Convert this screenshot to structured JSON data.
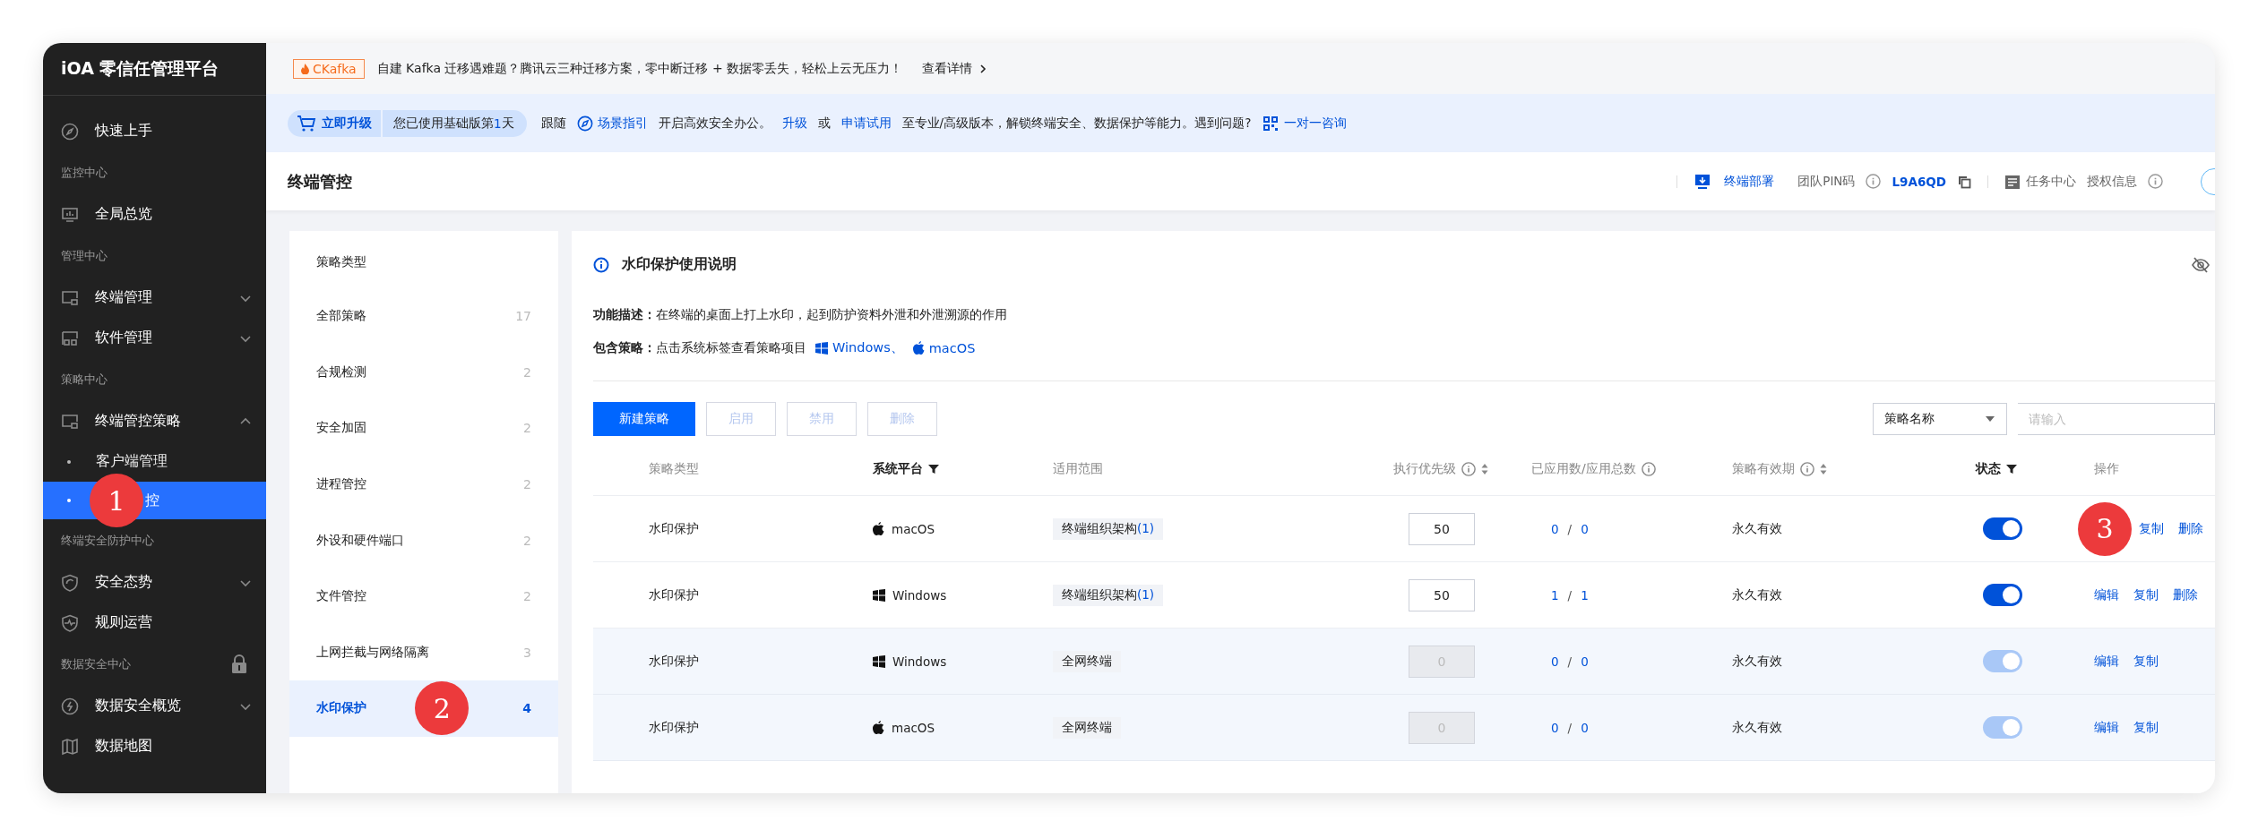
{
  "sidebar": {
    "title": "iOA 零信任管理平台",
    "items": [
      {
        "kind": "item",
        "label": "快速上手"
      },
      {
        "kind": "group",
        "label": "监控中心"
      },
      {
        "kind": "item",
        "label": "全局总览"
      },
      {
        "kind": "group",
        "label": "管理中心"
      },
      {
        "kind": "item",
        "label": "终端管理",
        "expanded": false
      },
      {
        "kind": "item",
        "label": "软件管理",
        "expanded": false
      },
      {
        "kind": "group",
        "label": "策略中心"
      },
      {
        "kind": "item",
        "label": "终端管控策略",
        "expanded": true
      },
      {
        "kind": "subitem",
        "label": "客户端管理",
        "selected": false
      },
      {
        "kind": "subitem",
        "label": "控",
        "selected": true,
        "marker": "1"
      },
      {
        "kind": "group",
        "label": "终端安全防护中心"
      },
      {
        "kind": "item",
        "label": "安全态势",
        "expanded": false
      },
      {
        "kind": "item",
        "label": "规则运营"
      },
      {
        "kind": "group",
        "label": "数据安全中心",
        "locked": true
      },
      {
        "kind": "item",
        "label": "数据安全概览",
        "expanded": false
      },
      {
        "kind": "item",
        "label": "数据地图"
      }
    ]
  },
  "promo": {
    "tag": "CKafka",
    "text": "自建 Kafka 迁移遇难题？腾讯云三种迁移方案，零中断迁移 + 数据零丢失，轻松上云无压力！",
    "link": "查看详情"
  },
  "upgrade": {
    "button": "立即升级",
    "usage_prefix": "您已使用基础版第",
    "usage_days": "1",
    "usage_suffix": "天",
    "parts": [
      {
        "kind": "text",
        "text": "跟随"
      },
      {
        "kind": "guide",
        "text": "场景指引"
      },
      {
        "kind": "text",
        "text": "开启高效安全办公。"
      },
      {
        "kind": "link",
        "text": "升级"
      },
      {
        "kind": "text",
        "text": "或"
      },
      {
        "kind": "link",
        "text": "申请试用"
      },
      {
        "kind": "text",
        "text": "至专业/高级版本，解锁终端安全、数据保护等能力。遇到问题?"
      },
      {
        "kind": "consult",
        "text": "一对一咨询"
      }
    ]
  },
  "header": {
    "title": "终端管控",
    "deploy": "终端部署",
    "pin_label": "团队PIN码",
    "pin": "L9A6QD",
    "tasks": "任务中心",
    "license": "授权信息"
  },
  "policy_types": {
    "title": "策略类型",
    "items": [
      {
        "name": "全部策略",
        "count": "17",
        "selected": false
      },
      {
        "name": "合规检测",
        "count": "2",
        "selected": false
      },
      {
        "name": "安全加固",
        "count": "2",
        "selected": false
      },
      {
        "name": "进程管控",
        "count": "2",
        "selected": false
      },
      {
        "name": "外设和硬件端口",
        "count": "2",
        "selected": false
      },
      {
        "name": "文件管控",
        "count": "2",
        "selected": false
      },
      {
        "name": "上网拦截与网络隔离",
        "count": "3",
        "selected": false
      },
      {
        "name": "水印保护",
        "count": "4",
        "selected": true,
        "marker": "2"
      }
    ]
  },
  "panel": {
    "title": "水印保护使用说明",
    "desc_label": "功能描述：",
    "desc": "在终端的桌面上打上水印，起到防护资料外泄和外泄溯源的作用",
    "include_label": "包含策略：",
    "include_text": "点击系统标签查看策略项目",
    "platforms": [
      {
        "kind": "windows",
        "label": "Windows、"
      },
      {
        "kind": "macos",
        "label": "macOS"
      }
    ]
  },
  "toolbar": {
    "buttons": [
      {
        "label": "新建策略",
        "kind": "primary",
        "disabled": false
      },
      {
        "label": "启用",
        "kind": "default",
        "disabled": true
      },
      {
        "label": "禁用",
        "kind": "default",
        "disabled": true
      },
      {
        "label": "删除",
        "kind": "default",
        "disabled": true
      }
    ],
    "search_select": "策略名称",
    "search": {
      "placeholder": "请输入"
    }
  },
  "table": {
    "columns": [
      {
        "label": "策略类型",
        "filter": false,
        "info": false,
        "sort": false
      },
      {
        "label": "系统平台",
        "filter": true,
        "info": false,
        "sort": false
      },
      {
        "label": "适用范围",
        "filter": false,
        "info": false,
        "sort": false
      },
      {
        "label": "执行优先级",
        "filter": false,
        "info": true,
        "sort": true
      },
      {
        "label": "已应用数/应用总数",
        "filter": false,
        "info": true,
        "sort": false
      },
      {
        "label": "策略有效期",
        "filter": false,
        "info": true,
        "sort": true
      },
      {
        "label": "状态",
        "filter": true,
        "info": false,
        "sort": false
      },
      {
        "label": "操作",
        "filter": false,
        "info": false,
        "sort": false
      }
    ],
    "rows": [
      {
        "type": "水印保护",
        "kind": "macos",
        "platform": "macOS",
        "scope": "终端组织架构",
        "scope_count": "(1)",
        "priority": "50",
        "applied": "0",
        "slash": "/",
        "total": "0",
        "validity": "永久有效",
        "on": true,
        "disabled": false,
        "marker": "3",
        "actions": [
          "复制",
          "删除"
        ]
      },
      {
        "type": "水印保护",
        "kind": "windows",
        "platform": "Windows",
        "scope": "终端组织架构",
        "scope_count": "(1)",
        "priority": "50",
        "applied": "1",
        "slash": "/",
        "total": "1",
        "validity": "永久有效",
        "on": true,
        "disabled": false,
        "actions": [
          "编辑",
          "复制",
          "删除"
        ]
      },
      {
        "type": "水印保护",
        "kind": "windows",
        "platform": "Windows",
        "scope": "全网终端",
        "priority": "0",
        "applied": "0",
        "slash": "/",
        "total": "0",
        "validity": "永久有效",
        "on": true,
        "disabled": true,
        "actions": [
          "编辑",
          "复制"
        ]
      },
      {
        "type": "水印保护",
        "kind": "macos",
        "platform": "macOS",
        "scope": "全网终端",
        "priority": "0",
        "applied": "0",
        "slash": "/",
        "total": "0",
        "validity": "永久有效",
        "on": true,
        "disabled": true,
        "actions": [
          "编辑",
          "复制"
        ]
      }
    ]
  }
}
